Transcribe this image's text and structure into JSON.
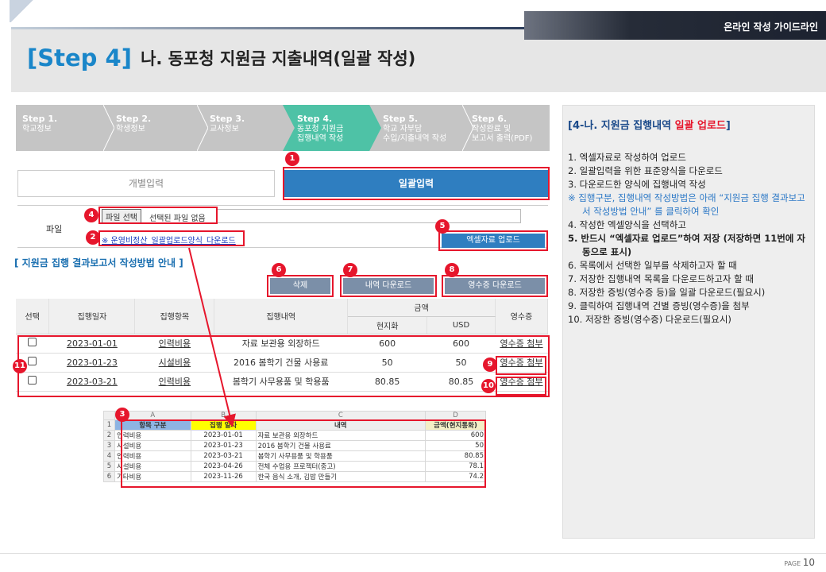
{
  "header": {
    "guide_tag": "온라인 작성 가이드라인",
    "step": "[Step 4]",
    "subtitle": "나. 동포청 지원금 지출내역(일괄 작성)"
  },
  "steps": [
    {
      "num": "Step 1.",
      "label": "학교정보",
      "label2": ""
    },
    {
      "num": "Step 2.",
      "label": "학생정보",
      "label2": ""
    },
    {
      "num": "Step 3.",
      "label": "교사정보",
      "label2": ""
    },
    {
      "num": "Step 4.",
      "label": "동포청 지원금",
      "label2": "집행내역 작성"
    },
    {
      "num": "Step 5.",
      "label": "학교 자부담",
      "label2": "수입/지출내역 작성"
    },
    {
      "num": "Step 6.",
      "label": "작성완료 및",
      "label2": "보고서 출력(PDF)"
    }
  ],
  "tabs": {
    "individual": "개별입력",
    "bulk": "일괄입력"
  },
  "file": {
    "label": "파일",
    "choose": "파일 선택",
    "none": "선택된 파일 없음",
    "template_link": "※ 운영비정산_일괄업로드양식_다운로드",
    "upload": "엑셀자료 업로드"
  },
  "guide_link": "[ 지원금 집행 결과보고서 작성방법 안내 ]",
  "buttons": {
    "delete": "삭제",
    "download_list": "내역 다운로드",
    "download_receipt": "영수증 다운로드"
  },
  "table": {
    "headers": {
      "select": "선택",
      "date": "집행일자",
      "item": "집행항목",
      "detail": "집행내역",
      "amount": "금액",
      "local": "현지화",
      "usd": "USD",
      "receipt": "영수증"
    },
    "rows": [
      {
        "date": "2023-01-01",
        "item": "인력비용",
        "detail": "자료 보관용 외장하드",
        "local": "600",
        "usd": "600",
        "receipt": "영수증 첨부"
      },
      {
        "date": "2023-01-23",
        "item": "시설비용",
        "detail": "2016 봄학기 건물 사용료",
        "local": "50",
        "usd": "50",
        "receipt": "영수증 첨부"
      },
      {
        "date": "2023-03-21",
        "item": "인력비용",
        "detail": "봄학기 사무용품 및 학용품",
        "local": "80.85",
        "usd": "80.85",
        "receipt": "영수증 첨부"
      }
    ]
  },
  "excel": {
    "cols": [
      "A",
      "B",
      "C",
      "D"
    ],
    "headers": [
      "항목 구분",
      "집행 일자",
      "내역",
      "금액(현지통화)"
    ],
    "rows": [
      {
        "n": "2",
        "a": "인력비용",
        "b": "2023-01-01",
        "c": "자료 보관용 외장하드",
        "d": "600"
      },
      {
        "n": "3",
        "a": "시설비용",
        "b": "2023-01-23",
        "c": "2016 봄학기 건물 사용료",
        "d": "50"
      },
      {
        "n": "4",
        "a": "인력비용",
        "b": "2023-03-21",
        "c": "봄학기 사무용품 및 학용품",
        "d": "80.85"
      },
      {
        "n": "5",
        "a": "시설비용",
        "b": "2023-04-26",
        "c": "전체 수업용 프로젝터(중고)",
        "d": "78.1"
      },
      {
        "n": "6",
        "a": "기타비용",
        "b": "2023-11-26",
        "c": "한국 음식 소개, 김밥 만들기",
        "d": "74.2"
      }
    ]
  },
  "badges": [
    "1",
    "2",
    "3",
    "4",
    "5",
    "6",
    "7",
    "8",
    "9",
    "10",
    "11"
  ],
  "panel": {
    "title_a": "[4-나. 지원금 집행내역 ",
    "title_b": "일괄 업로드",
    "title_c": "]",
    "lines": [
      "1.  엑셀자료로 작성하여 업로드",
      "2.  일괄입력을 위한 표준양식을 다운로드",
      "3.  다운로드한 양식에 집행내역 작성",
      "※ 집행구분, 집행내역 작성방법은 아래 “지원금 집행 결과보고서 작성방법 안내” 를 클릭하여 확인",
      "4.  작성한 엑셀양식을 선택하고",
      "5.  반드시 “엑셀자료 업로드”하여 저장 (저장하면 11번에 자동으로 표시)",
      "6.  목록에서 선택한 일부를 삭제하고자 할 때",
      "7.  저장한 집행내역 목록을 다운로드하고자 할 때",
      "8.  저장한 증빙(영수증 등)을 일괄 다운로드(필요시)",
      "9.  클릭하여 집행내역 건별 증빙(영수증)을 첨부",
      "10. 저장한 증빙(영수증) 다운로드(필요시)"
    ]
  },
  "footer": {
    "page_label": "PAGE",
    "page": "10"
  },
  "colors": {
    "accent": "#1a86c9",
    "annotation": "#e6162c",
    "active_step": "#4ec2a6",
    "button": "#2f7ec0"
  }
}
